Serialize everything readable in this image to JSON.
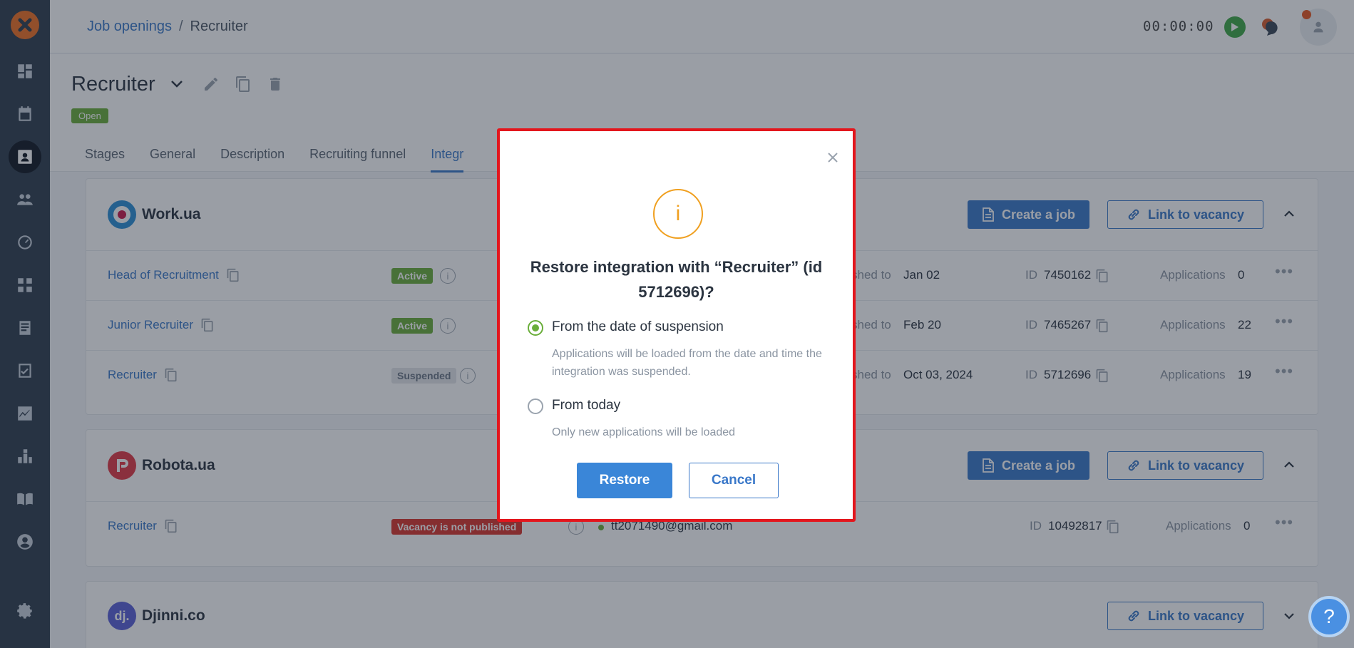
{
  "breadcrumb": {
    "parent": "Job openings",
    "separator": "/",
    "current": "Recruiter"
  },
  "timer": "00:00:00",
  "job": {
    "title": "Recruiter",
    "status": "Open"
  },
  "tabs": [
    "Stages",
    "General",
    "Description",
    "Recruiting funnel",
    "Integr"
  ],
  "workua": {
    "name": "Work.ua",
    "create_label": "Create a job",
    "link_label": "Link to vacancy",
    "rows": [
      {
        "name": "Head of Recruitment",
        "status": "Active",
        "published": "shed to",
        "published_date": "Jan 02",
        "id_label": "ID",
        "id": "7450162",
        "apps_label": "Applications",
        "apps": "0"
      },
      {
        "name": "Junior Recruiter",
        "status": "Active",
        "published": "shed to",
        "published_date": "Feb 20",
        "id_label": "ID",
        "id": "7465267",
        "apps_label": "Applications",
        "apps": "22"
      },
      {
        "name": "Recruiter",
        "status": "Suspended",
        "published": "shed to",
        "published_date": "Oct 03, 2024",
        "id_label": "ID",
        "id": "5712696",
        "apps_label": "Applications",
        "apps": "19"
      }
    ]
  },
  "robota": {
    "name": "Robota.ua",
    "create_label": "Create a job",
    "link_label": "Link to vacancy",
    "rows": [
      {
        "name": "Recruiter",
        "status": "Vacancy is not published",
        "email": "tt2071490@gmail.com",
        "id_label": "ID",
        "id": "10492817",
        "apps_label": "Applications",
        "apps": "0"
      }
    ]
  },
  "djinni": {
    "name": "Djinni.co",
    "logo": "dj.",
    "link_label": "Link to vacancy"
  },
  "modal": {
    "icon_glyph": "i",
    "title": "Restore integration with “Recruiter” (id 5712696)?",
    "option1_label": "From the date of suspension",
    "option1_desc": "Applications will be loaded from the date and time the integration was suspended.",
    "option2_label": "From today",
    "option2_desc": "Only new applications will be loaded",
    "restore_label": "Restore",
    "cancel_label": "Cancel",
    "selected_option": 1
  },
  "help_glyph": "?",
  "colors": {
    "accent": "#3a78c9",
    "brand_orange": "#f07022",
    "sidebar": "#2f3d4e",
    "success": "#6aae3a",
    "danger": "#d9342b",
    "modal_border": "#e3161d",
    "warning": "#f0a020"
  }
}
